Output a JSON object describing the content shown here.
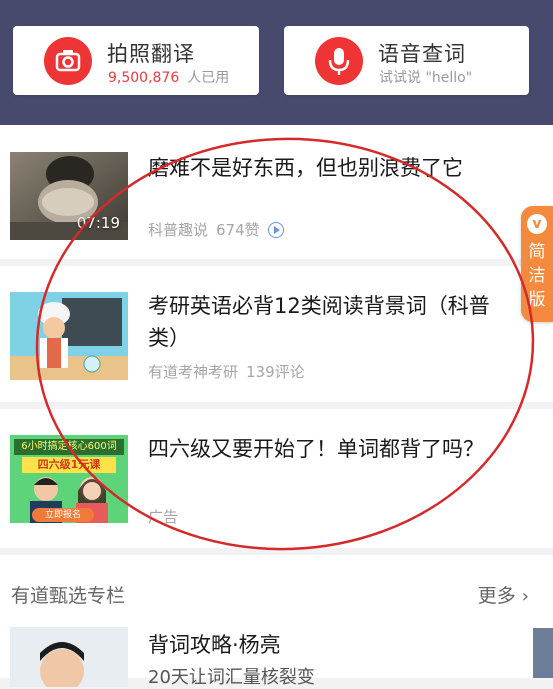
{
  "tools": {
    "photo": {
      "title": "拍照翻译",
      "count": "9,500,876",
      "count_suffix": "人已用"
    },
    "voice": {
      "title": "语音查词",
      "subtitle": "试试说 \"hello\""
    }
  },
  "feed": [
    {
      "title": "磨难不是好东西，但也别浪费了它",
      "source": "科普趣说",
      "stat": "674赞",
      "duration": "07:19"
    },
    {
      "title": "考研英语必背12类阅读背景词（科普类）",
      "source": "有道考神考研",
      "stat": "139评论"
    },
    {
      "title": "四六级又要开始了！单词都背了吗？",
      "source": "广告",
      "banner_top": "6小时搞定核心600词",
      "banner_mid": "四六级1元课",
      "banner_btn": "立即报名"
    }
  ],
  "section": {
    "title": "有道甄选专栏",
    "more": "更多",
    "item": {
      "title": "背词攻略·杨亮",
      "subtitle": "20天让词汇量核裂变"
    }
  },
  "float_tab": {
    "badge": "v",
    "label": "简洁版"
  },
  "colors": {
    "header": "#474a6c",
    "accent_red": "#ee3434",
    "tab_orange": "#f38a3d",
    "annotation_red": "#d42a2a"
  }
}
